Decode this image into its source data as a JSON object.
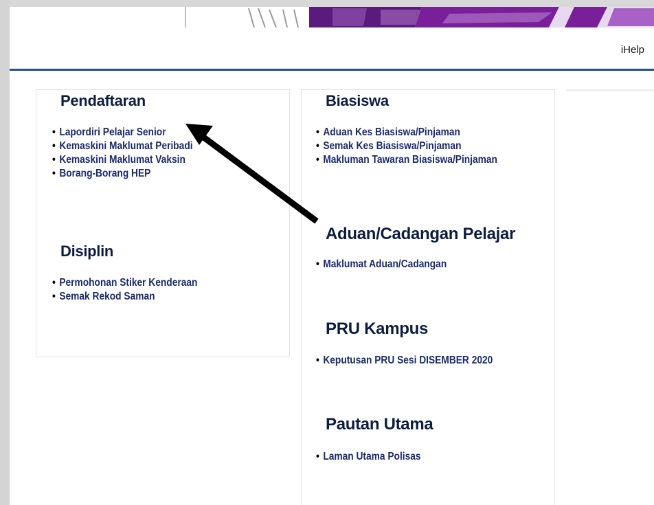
{
  "header": {
    "ihelp_label": "iHelp"
  },
  "colors": {
    "accent_rule": "#244f8c",
    "banner_purple": "#7a1f9a",
    "link_color": "#1a2a6c",
    "heading_color": "#0d1d3f"
  },
  "sections": {
    "pendaftaran": {
      "title": "Pendaftaran",
      "items": [
        "Lapordiri Pelajar Senior",
        "Kemaskini Maklumat Peribadi",
        "Kemaskini Maklumat Vaksin",
        "Borang-Borang HEP"
      ]
    },
    "disiplin": {
      "title": "Disiplin",
      "items": [
        "Permohonan Stiker Kenderaan",
        "Semak Rekod Saman"
      ]
    },
    "biasiswa": {
      "title": "Biasiswa",
      "items": [
        "Aduan Kes Biasiswa/Pinjaman",
        "Semak Kes Biasiswa/Pinjaman",
        "Makluman Tawaran Biasiswa/Pinjaman"
      ]
    },
    "aduan": {
      "title": "Aduan/Cadangan Pelajar",
      "items": [
        "Maklumat Aduan/Cadangan"
      ]
    },
    "pru": {
      "title": "PRU Kampus",
      "items": [
        "Keputusan PRU Sesi DISEMBER 2020"
      ]
    },
    "pautan": {
      "title": "Pautan Utama",
      "items": [
        "Laman Utama Polisas"
      ]
    }
  },
  "annotation": {
    "arrow_icon": "arrow-pointer-icon"
  }
}
